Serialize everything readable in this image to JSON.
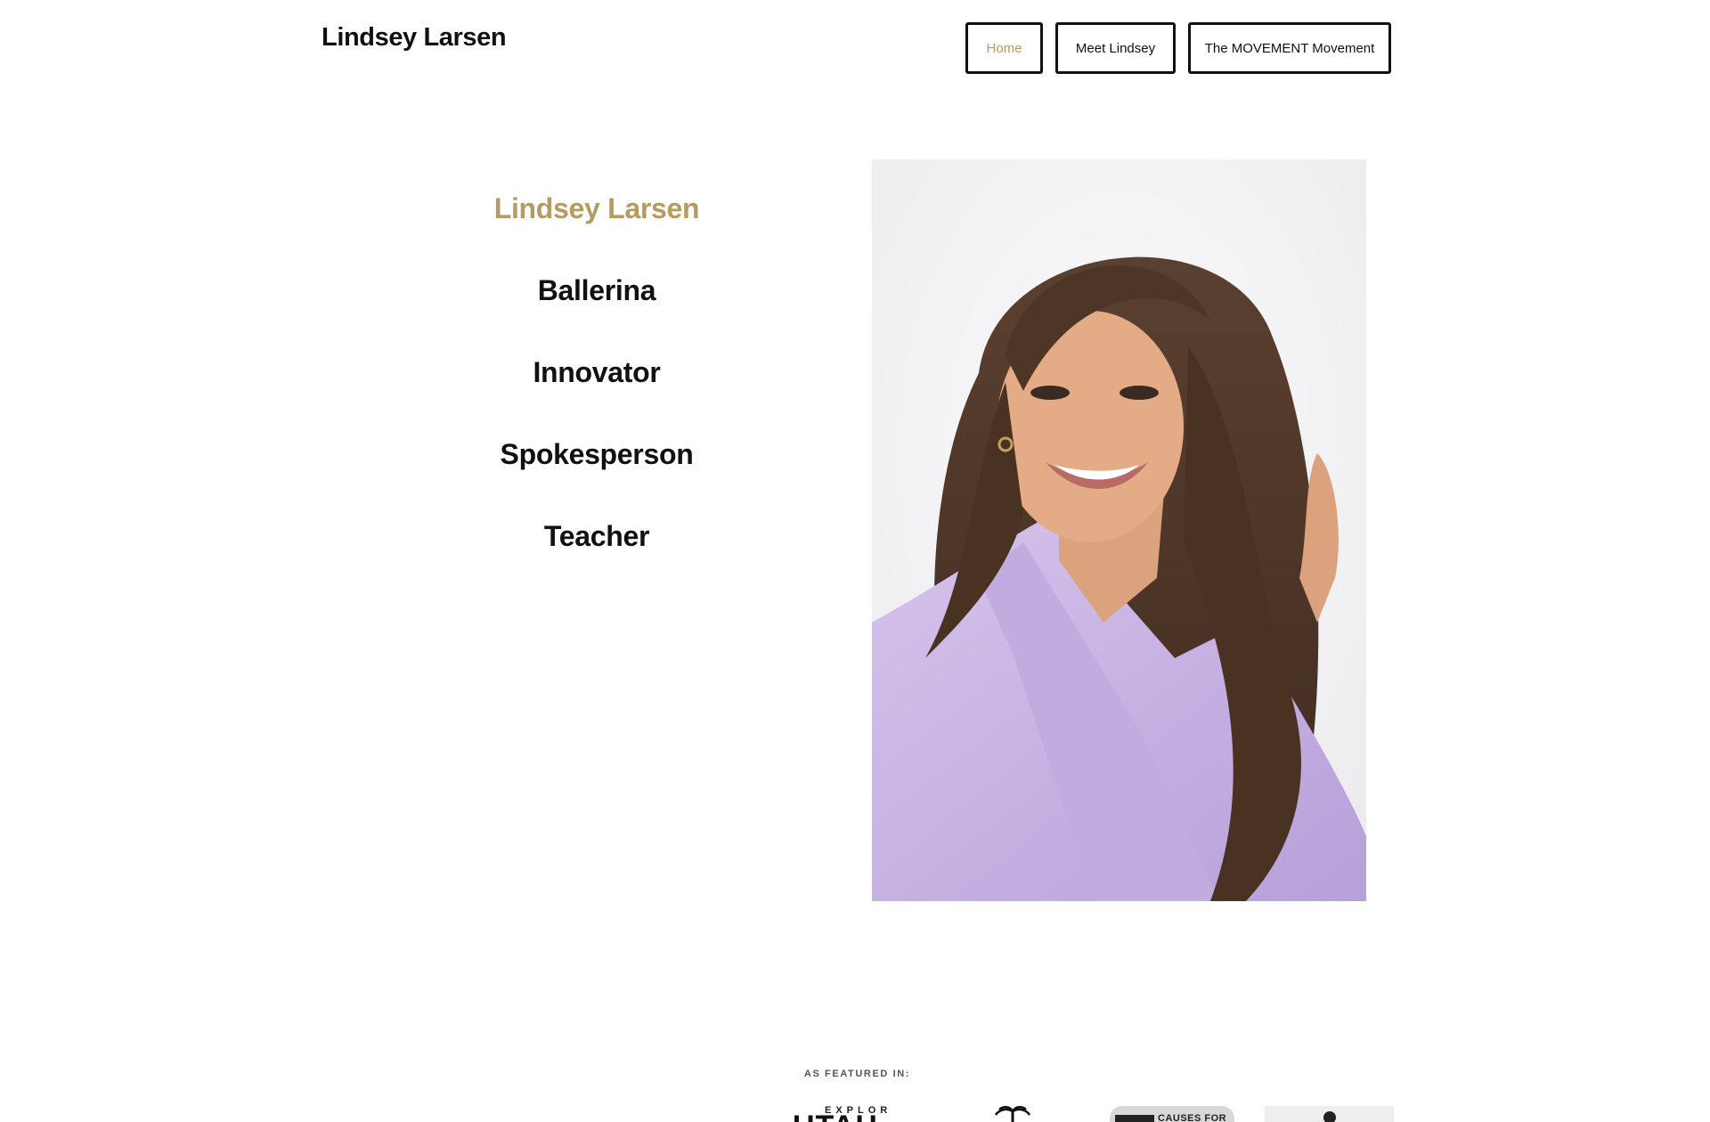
{
  "header": {
    "site_title": "Lindsey Larsen",
    "nav": [
      {
        "label": "Home",
        "active": true
      },
      {
        "label": "Meet Lindsey",
        "active": false
      },
      {
        "label": "The MOVEMENT Movement",
        "active": false
      }
    ]
  },
  "hero": {
    "name": "Lindsey Larsen",
    "roles": [
      "Ballerina",
      "Innovator",
      "Spokesperson",
      "Teacher"
    ],
    "portrait_icon": "portrait-photo"
  },
  "featured": {
    "label": "AS FEATURED IN:",
    "logos": [
      {
        "name": "explore-utah-logo",
        "text_top": "EXPLORE",
        "text_main": "UTAH"
      },
      {
        "name": "palm-tree-logo"
      },
      {
        "name": "causes-for-logo",
        "text": "CAUSES FOR"
      },
      {
        "name": "microphone-logo"
      }
    ]
  },
  "colors": {
    "accent": "#b59a62",
    "text": "#111111",
    "background": "#ffffff",
    "blazer": "#c9b4e4"
  }
}
